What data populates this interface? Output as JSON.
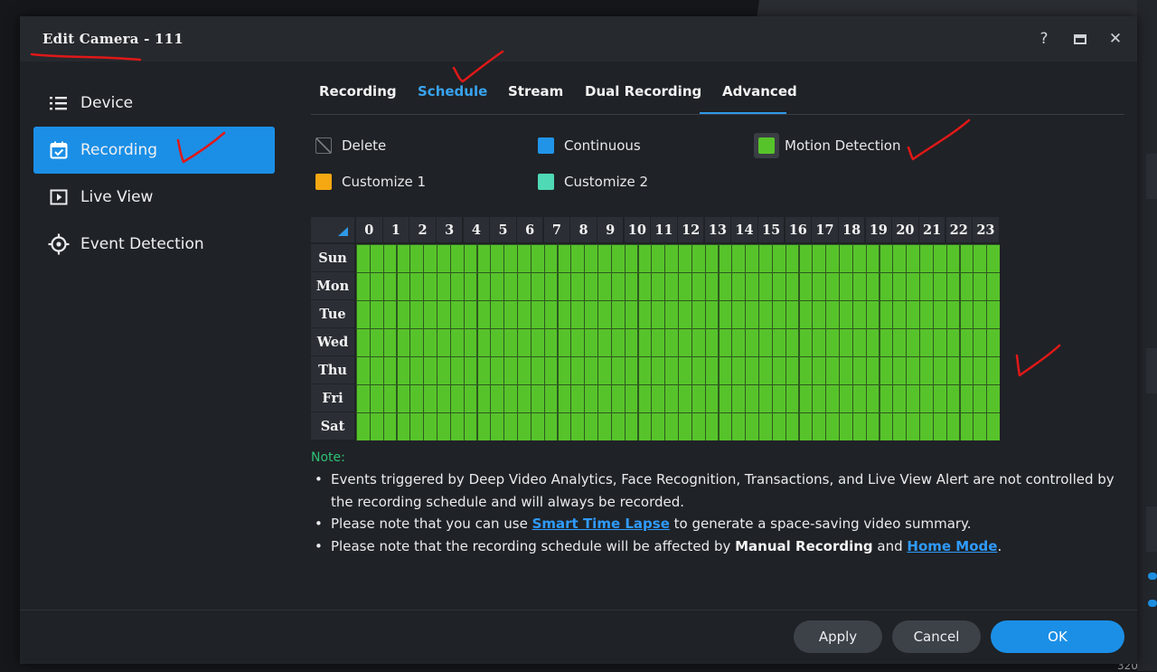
{
  "window": {
    "title": "Edit Camera - 111",
    "help": "?",
    "maximize": "maximize",
    "close": "✕"
  },
  "sidebar": {
    "items": [
      {
        "label": "Device",
        "icon": "list-icon"
      },
      {
        "label": "Recording",
        "icon": "calendar-check-icon",
        "active": true
      },
      {
        "label": "Live View",
        "icon": "play-box-icon"
      },
      {
        "label": "Event Detection",
        "icon": "crosshair-icon"
      }
    ]
  },
  "tabs": [
    {
      "label": "Recording"
    },
    {
      "label": "Schedule",
      "active": true
    },
    {
      "label": "Stream"
    },
    {
      "label": "Dual Recording"
    },
    {
      "label": "Advanced"
    }
  ],
  "legend": [
    {
      "label": "Delete",
      "color": "#1f2226"
    },
    {
      "label": "Continuous",
      "color": "#2194e8"
    },
    {
      "label": "Motion Detection",
      "color": "#57c32b",
      "selected": true
    },
    {
      "label": "Customize 1",
      "color": "#f5a812"
    },
    {
      "label": "Customize 2",
      "color": "#4fd9b5"
    }
  ],
  "schedule": {
    "hours": [
      "0",
      "1",
      "2",
      "3",
      "4",
      "5",
      "6",
      "7",
      "8",
      "9",
      "10",
      "11",
      "12",
      "13",
      "14",
      "15",
      "16",
      "17",
      "18",
      "19",
      "20",
      "21",
      "22",
      "23"
    ],
    "days": [
      "Sun",
      "Mon",
      "Tue",
      "Wed",
      "Thu",
      "Fri",
      "Sat"
    ],
    "fill_mode": "Motion Detection",
    "fill_color": "#57c32b",
    "half_hour_slots": true
  },
  "note": {
    "title": "Note:",
    "item1": "Events triggered by Deep Video Analytics, Face Recognition, Transactions, and Live View Alert are not controlled by the recording schedule and will always be recorded.",
    "item2_pre": "Please note that you can use ",
    "item2_link": "Smart Time Lapse",
    "item2_post": " to generate a space-saving video summary.",
    "item3_pre": "Please note that the recording schedule will be affected by ",
    "item3_bold": "Manual Recording",
    "item3_mid": " and ",
    "item3_link": "Home Mode",
    "item3_post": "."
  },
  "buttons": {
    "apply": "Apply",
    "cancel": "Cancel",
    "ok": "OK"
  },
  "background": {
    "number": "320"
  }
}
